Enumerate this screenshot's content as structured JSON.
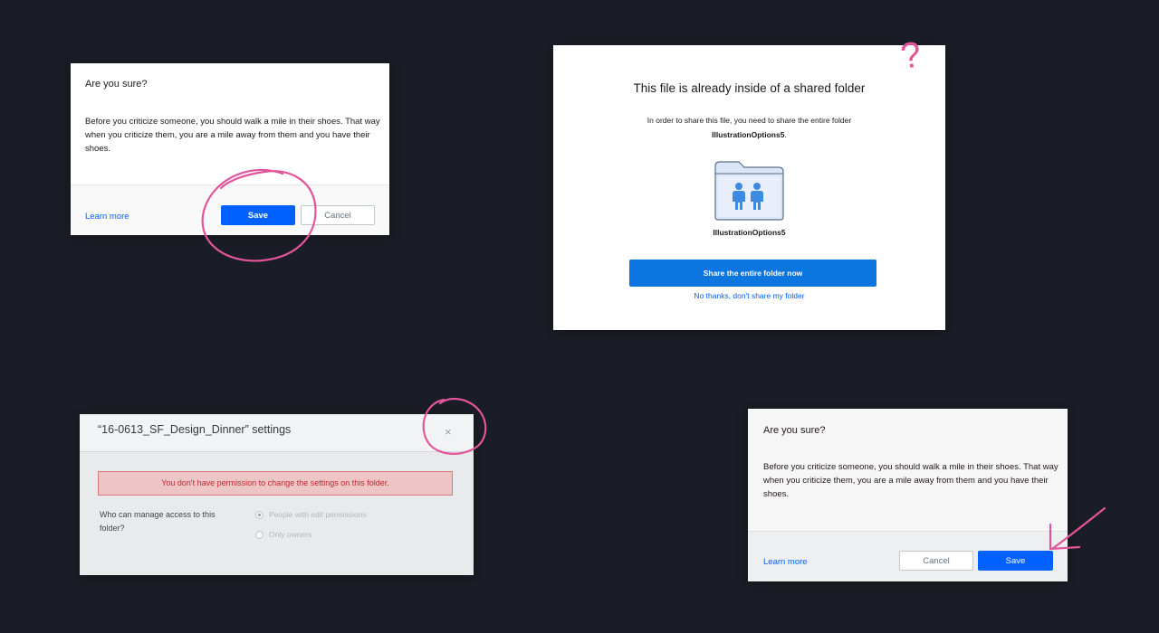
{
  "dialog_top_left": {
    "title": "Are you sure?",
    "body": "Before you criticize someone, you should walk a mile in their shoes. That way when you criticize them, you are a mile away from them and you have their shoes.",
    "learn_more": "Learn more",
    "save_label": "Save",
    "cancel_label": "Cancel"
  },
  "dialog_shared_folder": {
    "title": "This file is already inside of a shared folder",
    "subtitle": "In order to share this file, you need to share the entire folder",
    "folder_name_bold": "IllustrationOptions5",
    "folder_label": "IllustrationOptions5",
    "share_button": "Share the entire folder now",
    "decline_link": "No thanks, don't share my folder"
  },
  "dialog_settings": {
    "title": "“16-0613_SF_Design_Dinner” settings",
    "close_glyph": "×",
    "alert": "You don't have permission to change the settings on this folder.",
    "question": "Who can manage access to this folder?",
    "options": [
      {
        "label": "People with edit permissions",
        "selected": true
      },
      {
        "label": "Only owners",
        "selected": false
      }
    ]
  },
  "dialog_bottom_right": {
    "title": "Are you sure?",
    "body": "Before you criticize someone, you should walk a mile in their shoes. That way when you criticize them, you are a mile away from them and you have their shoes.",
    "learn_more": "Learn more",
    "cancel_label": "Cancel",
    "save_label": "Save"
  },
  "annotations": {
    "question_mark": "?",
    "color": "#e2559a"
  },
  "colors": {
    "background": "#1a1d25",
    "primary_blue": "#0061fe",
    "alert_red": "#c0272d"
  }
}
